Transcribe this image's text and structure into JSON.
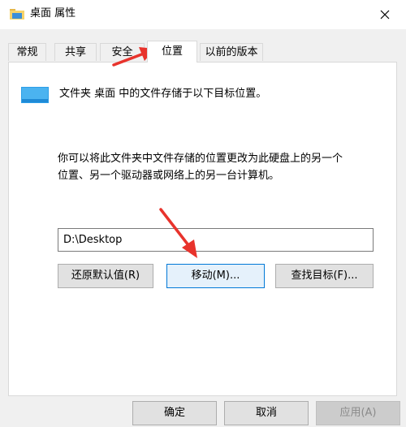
{
  "window": {
    "title": "桌面 属性",
    "icon": "folder-icon",
    "close_glyph": "✕"
  },
  "tabs": [
    {
      "label": "常规",
      "active": false
    },
    {
      "label": "共享",
      "active": false
    },
    {
      "label": "安全",
      "active": false
    },
    {
      "label": "位置",
      "active": true
    },
    {
      "label": "以前的版本",
      "active": false
    }
  ],
  "location": {
    "folder_line": "文件夹 桌面 中的文件存储于以下目标位置。",
    "description_line1": "你可以将此文件夹中文件存储的位置更改为此硬盘上的另一个",
    "description_line2": "位置、另一个驱动器或网络上的另一台计算机。",
    "path_value": "D:\\Desktop",
    "restore_default_label": "还原默认值(R)",
    "move_label": "移动(M)...",
    "find_target_label": "查找目标(F)..."
  },
  "footer": {
    "ok_label": "确定",
    "cancel_label": "取消",
    "apply_label": "应用(A)"
  },
  "colors": {
    "annotation_arrow": "#e8332c",
    "focus_border": "#0078d7",
    "folder_blue": "#2c9ee8"
  }
}
